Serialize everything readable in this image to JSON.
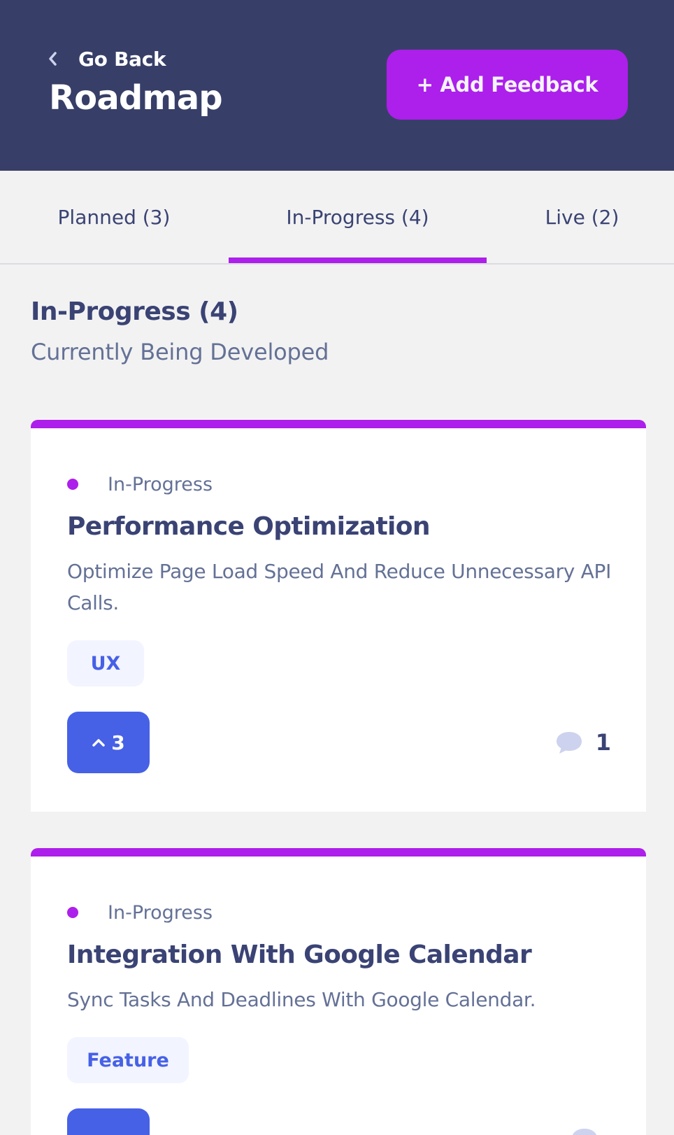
{
  "header": {
    "back_label": "Go Back",
    "title": "Roadmap",
    "add_button_label": "+ Add Feedback"
  },
  "tabs": [
    {
      "label": "Planned (3)"
    },
    {
      "label": "In-Progress (4)",
      "active": true
    },
    {
      "label": "Live (2)"
    }
  ],
  "section": {
    "title": "In-Progress (4)",
    "subtitle": "Currently Being Developed"
  },
  "cards": [
    {
      "status": "In-Progress",
      "title": "Performance Optimization",
      "description": "Optimize Page Load Speed And Reduce Unnecessary API Calls.",
      "tag": "UX",
      "upvotes": "3",
      "comments": "1"
    },
    {
      "status": "In-Progress",
      "title": "Integration With Google Calendar",
      "description": "Sync Tasks And Deadlines With Google Calendar.",
      "tag": "Feature",
      "upvotes": "",
      "comments": ""
    }
  ],
  "icons": {
    "back": "chevron-left-icon",
    "upvote": "chevron-up-icon",
    "comments": "comment-bubble-icon"
  },
  "colors": {
    "header_bg": "#373F68",
    "accent_purple": "#AD1FEA",
    "accent_blue": "#4661E6",
    "title_text": "#3A4374",
    "body_text": "#647196",
    "page_bg": "#F2F2F2",
    "tag_bg": "#F2F4FF",
    "comment_icon": "#CDD2EE"
  }
}
